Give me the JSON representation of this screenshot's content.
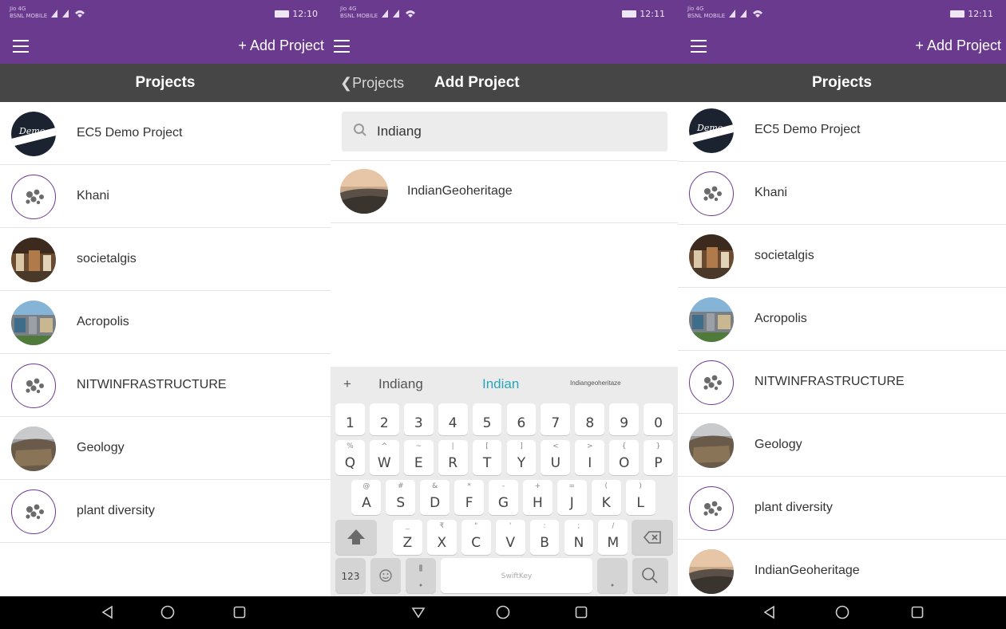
{
  "status": {
    "carrier": "Jio 4G",
    "carrier2": "BSNL MOBILE",
    "time_left": "12:10",
    "time_mid": "12:11",
    "time_right": "12:11"
  },
  "screen1": {
    "add_project": "+ Add Project",
    "title": "Projects",
    "projects": [
      {
        "name": "EC5 Demo Project",
        "avatar": "demo-logo",
        "avatar_text": "Demo"
      },
      {
        "name": "Khani",
        "avatar": "epicollect-logo"
      },
      {
        "name": "societalgis",
        "avatar": "photo-street"
      },
      {
        "name": "Acropolis",
        "avatar": "photo-building"
      },
      {
        "name": "NITWINFRASTRUCTURE",
        "avatar": "epicollect-logo"
      },
      {
        "name": "Geology",
        "avatar": "photo-rock"
      },
      {
        "name": "plant diversity",
        "avatar": "epicollect-logo"
      }
    ]
  },
  "screen2": {
    "back_label": "Projects",
    "title": "Add Project",
    "search_value": "Indiang",
    "result": "IndianGeoheritage",
    "suggestions": [
      "Indiang",
      "Indian",
      "Indiangeoheritaze"
    ],
    "keys": {
      "row1": [
        "1",
        "2",
        "3",
        "4",
        "5",
        "6",
        "7",
        "8",
        "9",
        "0"
      ],
      "row2": [
        [
          "Q",
          "%"
        ],
        [
          "W",
          "^"
        ],
        [
          "E",
          "~"
        ],
        [
          "R",
          "|"
        ],
        [
          "T",
          "["
        ],
        [
          "Y",
          "]"
        ],
        [
          "U",
          "<"
        ],
        [
          "I",
          ">"
        ],
        [
          "O",
          "{"
        ],
        [
          "P",
          "}"
        ]
      ],
      "row3": [
        [
          "A",
          "@"
        ],
        [
          "S",
          "#"
        ],
        [
          "D",
          "&"
        ],
        [
          "F",
          "*"
        ],
        [
          "G",
          "-"
        ],
        [
          "H",
          "+"
        ],
        [
          "J",
          "="
        ],
        [
          "K",
          "("
        ],
        [
          "L",
          ")"
        ]
      ],
      "row4": [
        [
          "Z",
          "_"
        ],
        [
          "X",
          "₹"
        ],
        [
          "C",
          "\""
        ],
        [
          "V",
          "'"
        ],
        [
          "B",
          ":"
        ],
        [
          "N",
          ";"
        ],
        [
          "M",
          "/"
        ]
      ],
      "num_key": "123",
      "space_label": "SwiftKey",
      "plus": "+"
    }
  },
  "screen3": {
    "add_project": "+ Add Project",
    "title": "Projects",
    "projects": [
      {
        "name": "EC5 Demo Project",
        "avatar": "demo-logo",
        "avatar_text": "Demo"
      },
      {
        "name": "Khani",
        "avatar": "epicollect-logo"
      },
      {
        "name": "societalgis",
        "avatar": "photo-street"
      },
      {
        "name": "Acropolis",
        "avatar": "photo-building"
      },
      {
        "name": "NITWINFRASTRUCTURE",
        "avatar": "epicollect-logo"
      },
      {
        "name": "Geology",
        "avatar": "photo-rock"
      },
      {
        "name": "plant diversity",
        "avatar": "epicollect-logo"
      },
      {
        "name": "IndianGeoheritage",
        "avatar": "photo-landscape"
      }
    ]
  },
  "colors": {
    "app_purple": "#6a3a8f",
    "title_gray": "#464646",
    "accent_teal": "#2aa6b8"
  }
}
